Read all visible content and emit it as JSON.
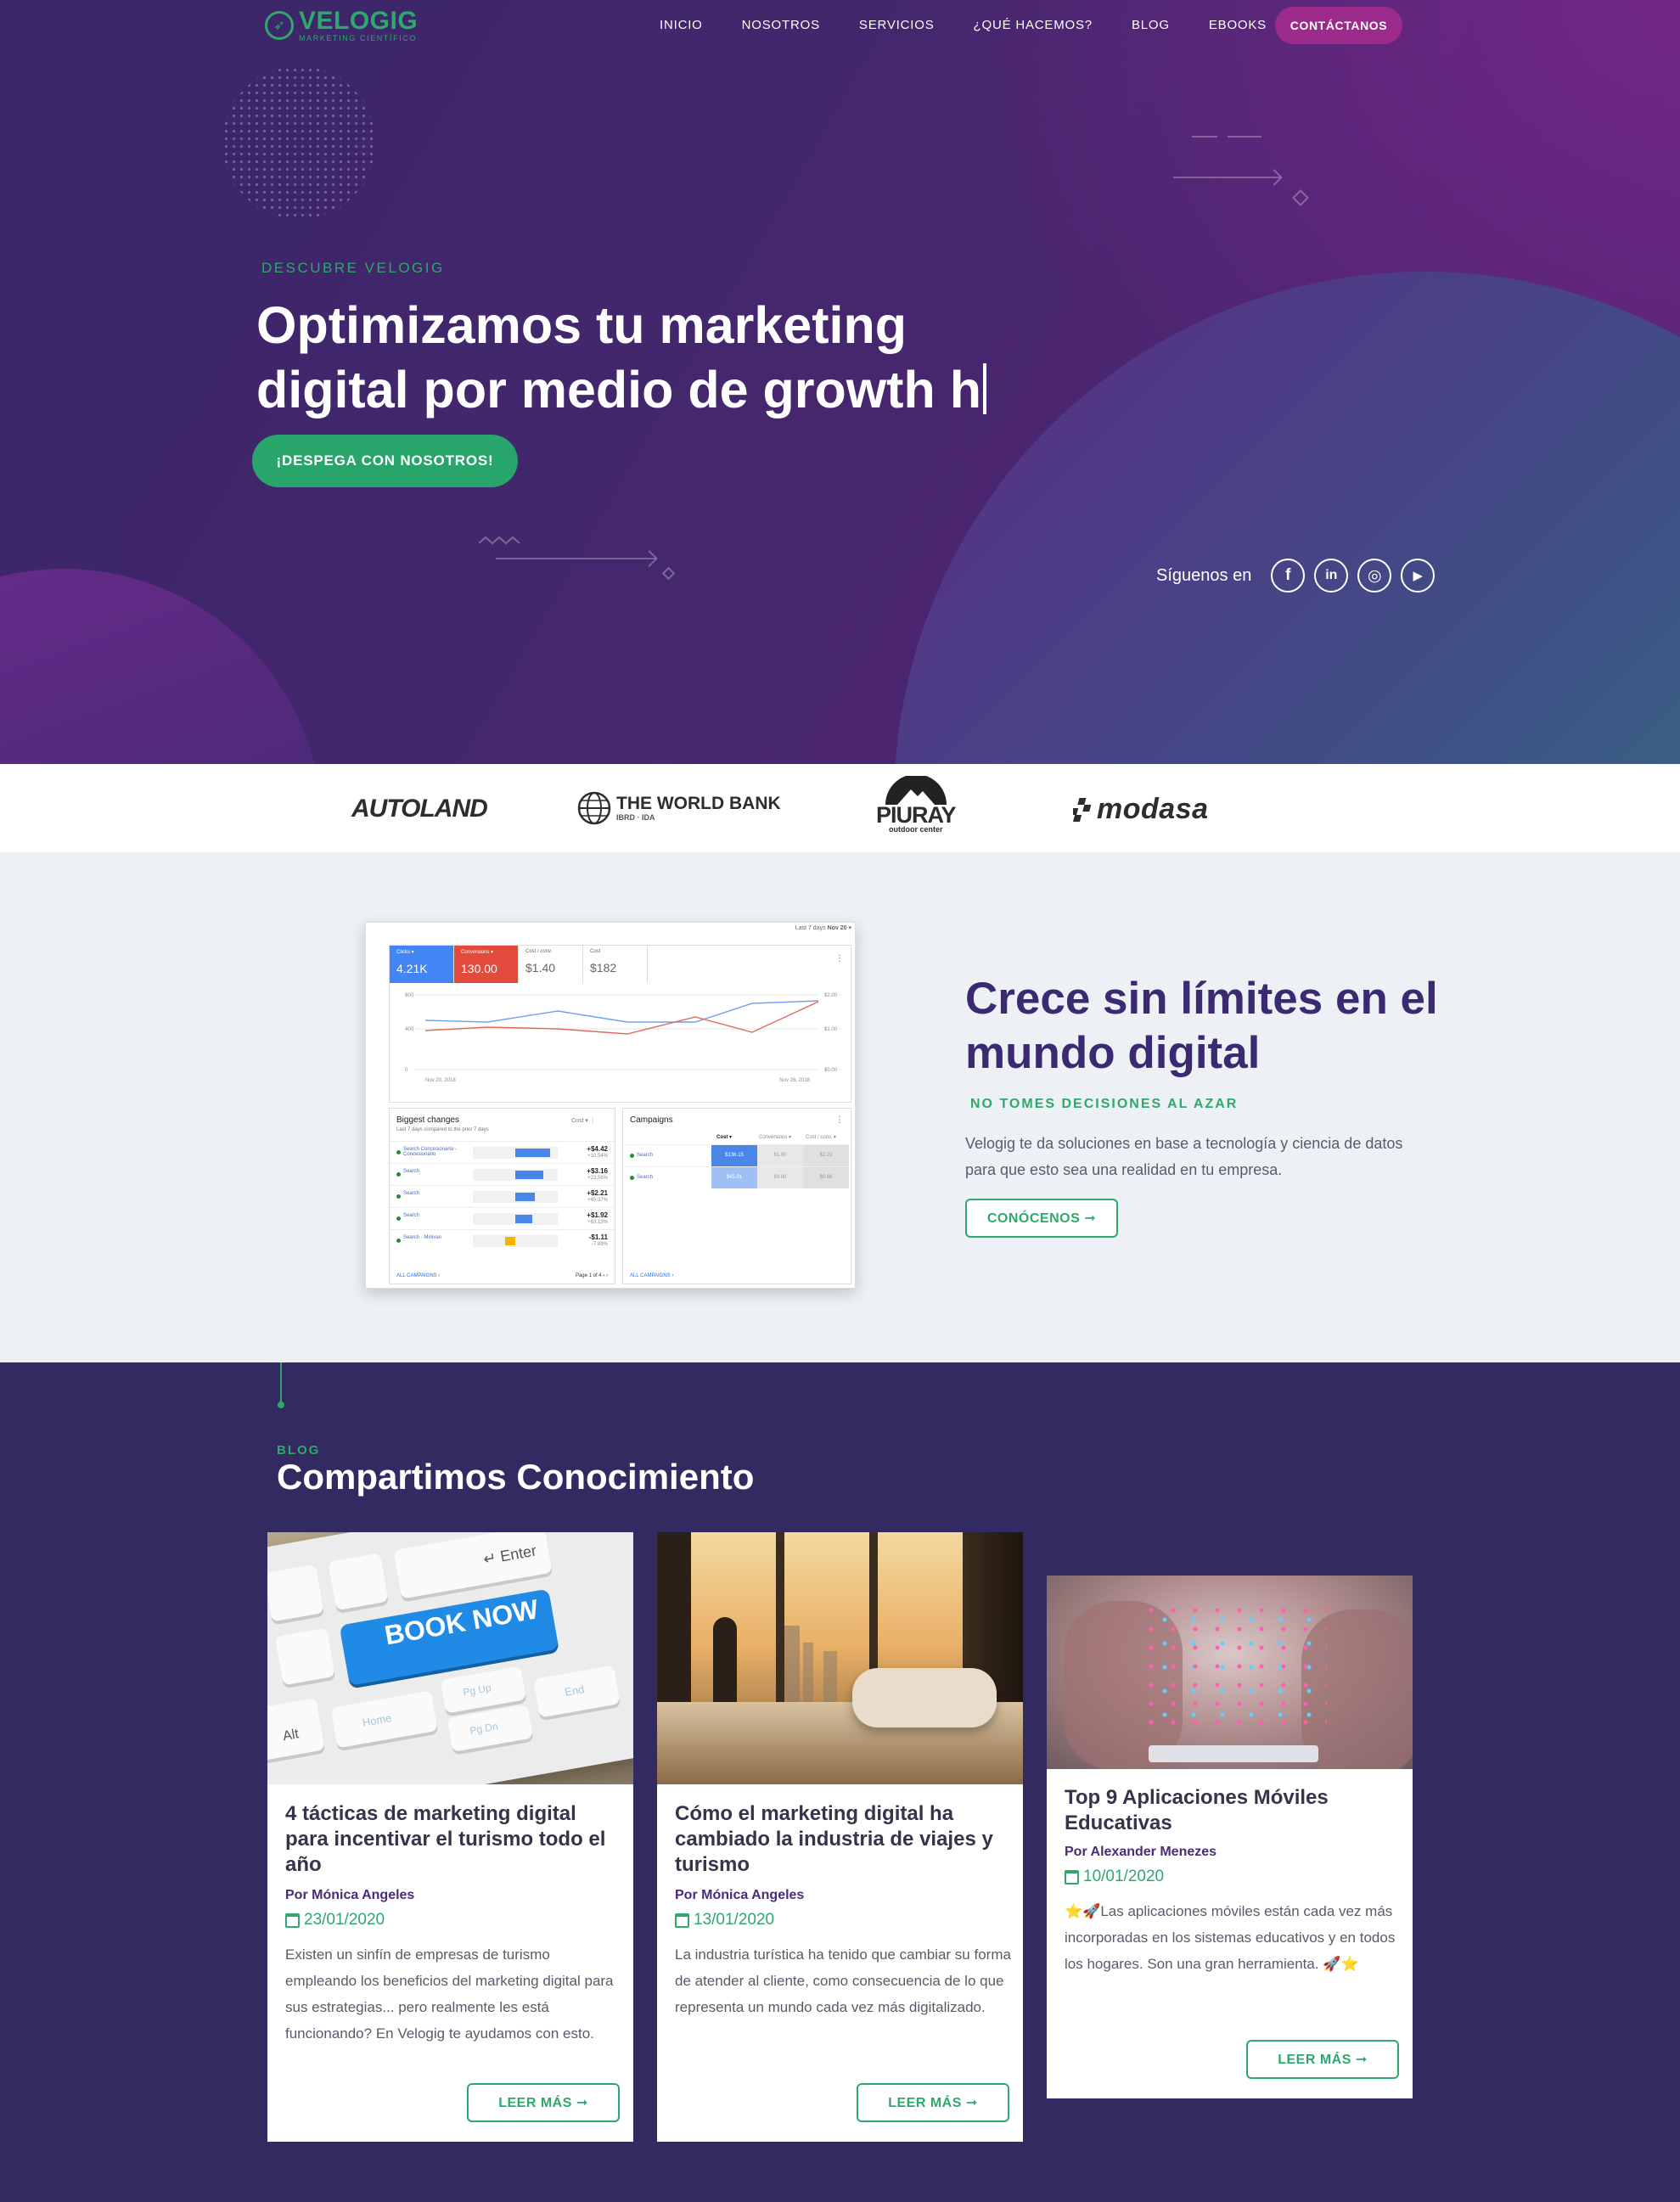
{
  "nav": {
    "logo_name": "VELOGIG",
    "logo_tagline": "MARKETING CIENTÍFICO",
    "items": [
      "INICIO",
      "NOSOTROS",
      "SERVICIOS",
      "¿QUÉ HACEMOS?",
      "BLOG",
      "EBOOKS"
    ],
    "cta": "CONTÁCTANOS"
  },
  "hero": {
    "eyebrow": "DESCUBRE VELOGIG",
    "title_line1": "Optimizamos tu marketing",
    "title_line2": "digital por medio de growth h",
    "cta": "¡DESPEGA CON NOSOTROS!",
    "follow_label": "Síguenos en",
    "social": [
      {
        "name": "facebook-icon",
        "glyph": "f"
      },
      {
        "name": "linkedin-icon",
        "glyph": "in"
      },
      {
        "name": "instagram-icon",
        "glyph": "◎"
      },
      {
        "name": "youtube-icon",
        "glyph": "▶"
      }
    ]
  },
  "clients": {
    "autoland": "AUTOLAND",
    "worldbank": "THE WORLD BANK",
    "worldbank_sub": "IBRD · IDA",
    "piuray": "PIURAY",
    "piuray_sub": "outdoor center",
    "modasa": "modasa"
  },
  "dashboard": {
    "range_label": "Last 7 days",
    "range_value": "Nov 20",
    "metrics": [
      {
        "label": "Clicks",
        "value": "4.21K",
        "color": "#4285f4"
      },
      {
        "label": "Conversions",
        "value": "130.00",
        "color": "#e24a3b"
      },
      {
        "label": "Cost / conv.",
        "value": "$1.40",
        "color": "#ffffff"
      },
      {
        "label": "Cost",
        "value": "$182",
        "color": "#ffffff"
      }
    ],
    "y_left": [
      "800",
      "400",
      "0"
    ],
    "y_right": [
      "$2.00",
      "$1.00",
      "$0.00"
    ],
    "x_start": "Nov 20, 2018",
    "x_end": "Nov 26, 2018",
    "changes_title": "Biggest changes",
    "changes_sub": "Last 7 days compared to the prior 7 days",
    "changes_filter": "Cost",
    "changes": [
      {
        "name": "Search Concesionario - Concesionario",
        "value": "+$4.42",
        "pct": "+10.54%",
        "bar": 0.9,
        "color": "#4a86e8"
      },
      {
        "name": "Search",
        "value": "+$3.16",
        "pct": "+23.56%",
        "bar": 0.72,
        "color": "#4a86e8"
      },
      {
        "name": "Search",
        "value": "+$2.21",
        "pct": "+45.37%",
        "bar": 0.5,
        "color": "#4a86e8"
      },
      {
        "name": "Search",
        "value": "+$1.92",
        "pct": "+83.13%",
        "bar": 0.44,
        "color": "#4a86e8"
      },
      {
        "name": "Search - Minivan",
        "value": "-$1.11",
        "pct": "-7.89%",
        "bar": 0.25,
        "color": "#f4b400"
      }
    ],
    "changes_link": "ALL CAMPAIGNS",
    "changes_page": "Page 1 of 4",
    "campaigns_title": "Campaigns",
    "campaigns_cols": [
      "Cost",
      "Conversions",
      "Cost / conv."
    ],
    "campaigns": [
      {
        "name": "Search",
        "cost": "$136.15",
        "conv": "61.00",
        "cpc": "$2.23"
      },
      {
        "name": "Search",
        "cost": "$45.91",
        "conv": "69.00",
        "cpc": "$0.66"
      }
    ],
    "campaigns_link": "ALL CAMPAIGNS"
  },
  "grow": {
    "title": "Crece sin límites en el mundo digital",
    "subtitle": "NO TOMES DECISIONES AL AZAR",
    "text": "Velogig te da soluciones en base a tecnología y ciencia de datos para que esto sea una realidad en tu empresa.",
    "cta": "CONÓCENOS ➞"
  },
  "blog": {
    "eyebrow": "BLOG",
    "title": "Compartimos Conocimiento",
    "cards": [
      {
        "title": "4 tácticas de marketing digital para incentivar el turismo todo el año",
        "author": "Por Mónica Angeles",
        "date": "23/01/2020",
        "excerpt": "Existen un sinfín de empresas de turismo empleando los beneficios del marketing digital para sus estrategias... pero realmente les está funcionando? En Velogig te ayudamos con esto.",
        "cta": "LEER MÁS ➞",
        "img_book": "BOOK NOW",
        "img_enter": "Enter",
        "img_alt": "Alt",
        "img_home": "Home",
        "img_end": "End",
        "img_pgup": "Pg Up",
        "img_pgdn": "Pg Dn"
      },
      {
        "title": "Cómo el marketing digital ha cambiado la industria de viajes y turismo",
        "author": "Por Mónica Angeles",
        "date": "13/01/2020",
        "excerpt": "La industria turística ha tenido que cambiar su forma de atender al cliente, como consecuencia de lo que representa un mundo cada vez más digitalizado.",
        "cta": "LEER MÁS ➞"
      },
      {
        "title": "Top 9 Aplicaciones Móviles Educativas",
        "author": "Por Alexander Menezes",
        "date": "10/01/2020",
        "excerpt": "⭐🚀Las aplicaciones móviles están cada vez más incorporadas en los sistemas educativos y en todos los hogares. Son una gran herramienta. 🚀⭐",
        "cta": "LEER MÁS ➞"
      }
    ]
  }
}
